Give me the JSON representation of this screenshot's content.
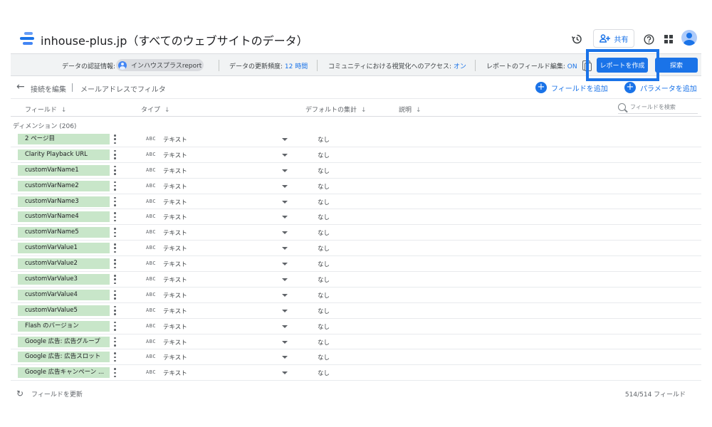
{
  "header": {
    "title": "inhouse-plus.jp（すべてのウェブサイトのデータ）",
    "share_label": "共有"
  },
  "infobar": {
    "credential_label": "データの認証情報:",
    "credential_value": "インハウスプラスreport",
    "refresh_label": "データの更新頻度:",
    "refresh_value": "12 時間",
    "community_label": "コミュニティにおける視覚化へのアクセス:",
    "community_value": "オン",
    "field_edit_label": "レポートのフィールド編集:",
    "field_edit_value": "ON",
    "create_report": "レポートを作成",
    "explore": "探索"
  },
  "toolbar": {
    "edit_connection": "接続を編集",
    "filter": "メールアドレスでフィルタ",
    "add_field": "フィールドを追加",
    "add_parameter": "パラメータを追加"
  },
  "columns": {
    "field": "フィールド",
    "type": "タイプ",
    "aggregation": "デフォルトの集計",
    "description": "説明",
    "search_placeholder": "フィールドを検索"
  },
  "section": {
    "label": "ディメンション (206)"
  },
  "rows": [
    {
      "field": "2 ページ目",
      "type_icon": "ABC",
      "type": "テキスト",
      "aggregation": "なし"
    },
    {
      "field": "Clarity Playback URL",
      "type_icon": "ABC",
      "type": "テキスト",
      "aggregation": "なし"
    },
    {
      "field": "customVarName1",
      "type_icon": "ABC",
      "type": "テキスト",
      "aggregation": "なし"
    },
    {
      "field": "customVarName2",
      "type_icon": "ABC",
      "type": "テキスト",
      "aggregation": "なし"
    },
    {
      "field": "customVarName3",
      "type_icon": "ABC",
      "type": "テキスト",
      "aggregation": "なし"
    },
    {
      "field": "customVarName4",
      "type_icon": "ABC",
      "type": "テキスト",
      "aggregation": "なし"
    },
    {
      "field": "customVarName5",
      "type_icon": "ABC",
      "type": "テキスト",
      "aggregation": "なし"
    },
    {
      "field": "customVarValue1",
      "type_icon": "ABC",
      "type": "テキスト",
      "aggregation": "なし"
    },
    {
      "field": "customVarValue2",
      "type_icon": "ABC",
      "type": "テキスト",
      "aggregation": "なし"
    },
    {
      "field": "customVarValue3",
      "type_icon": "ABC",
      "type": "テキスト",
      "aggregation": "なし"
    },
    {
      "field": "customVarValue4",
      "type_icon": "ABC",
      "type": "テキスト",
      "aggregation": "なし"
    },
    {
      "field": "customVarValue5",
      "type_icon": "ABC",
      "type": "テキスト",
      "aggregation": "なし"
    },
    {
      "field": "Flash のバージョン",
      "type_icon": "ABC",
      "type": "テキスト",
      "aggregation": "なし"
    },
    {
      "field": "Google 広告: 広告グループ",
      "type_icon": "ABC",
      "type": "テキスト",
      "aggregation": "なし"
    },
    {
      "field": "Google 広告: 広告スロット",
      "type_icon": "ABC",
      "type": "テキスト",
      "aggregation": "なし"
    },
    {
      "field": "Google 広告キャンペーン ...",
      "type_icon": "ABC",
      "type": "テキスト",
      "aggregation": "なし"
    }
  ],
  "footer": {
    "refresh_fields": "フィールドを更新",
    "count": "514/514 フィールド"
  },
  "colors": {
    "accent": "#1a73e8",
    "chip": "#c8e6c9",
    "infobar_bg": "#f1f3f4"
  }
}
